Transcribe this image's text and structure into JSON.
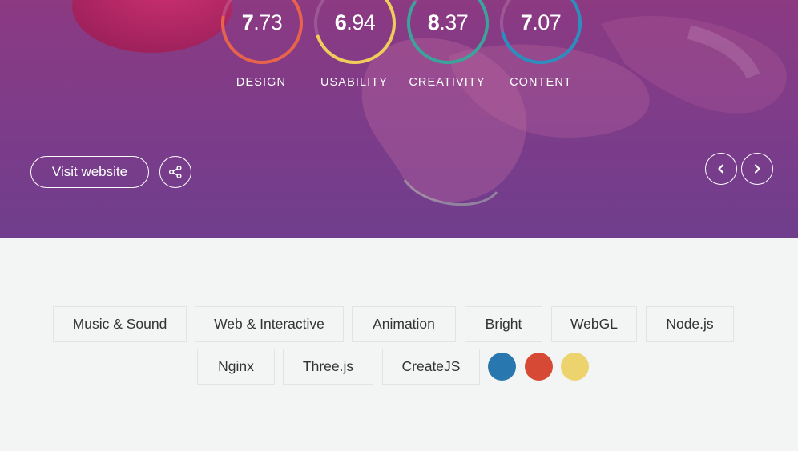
{
  "scores": [
    {
      "int": "7",
      "dec": ".73",
      "label": "DESIGN",
      "value": 7.73,
      "color": "#e8634a"
    },
    {
      "int": "6",
      "dec": ".94",
      "label": "USABILITY",
      "value": 6.94,
      "color": "#f0cc5a"
    },
    {
      "int": "8",
      "dec": ".37",
      "label": "CREATIVITY",
      "value": 8.37,
      "color": "#3aa39a"
    },
    {
      "int": "7",
      "dec": ".07",
      "label": "CONTENT",
      "value": 7.07,
      "color": "#2a8fbf"
    }
  ],
  "actions": {
    "visit_label": "Visit website",
    "share_icon": "share-icon",
    "prev_icon": "chevron-left-icon",
    "next_icon": "chevron-right-icon"
  },
  "tags": [
    "Music & Sound",
    "Web & Interactive",
    "Animation",
    "Bright",
    "WebGL",
    "Node.js",
    "Nginx",
    "Three.js",
    "CreateJS"
  ],
  "colors": [
    "#2877ae",
    "#d64a35",
    "#ecd36d"
  ]
}
